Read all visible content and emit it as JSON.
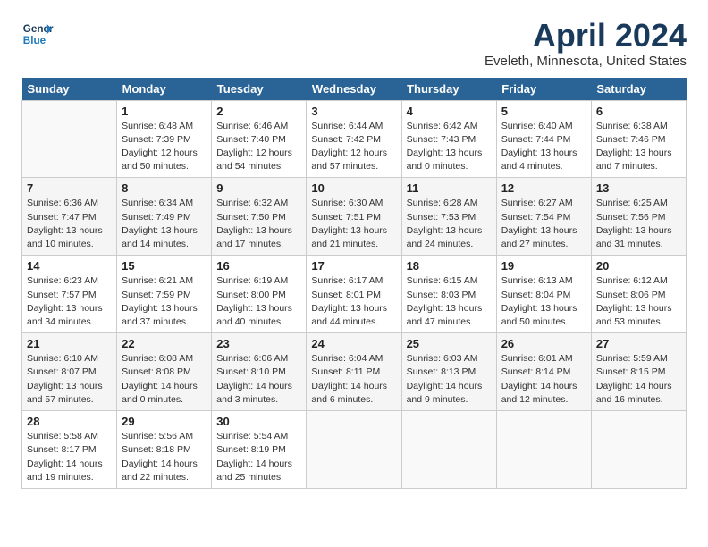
{
  "app": {
    "logo_line1": "General",
    "logo_line2": "Blue"
  },
  "title": {
    "month": "April 2024",
    "location": "Eveleth, Minnesota, United States"
  },
  "days_of_week": [
    "Sunday",
    "Monday",
    "Tuesday",
    "Wednesday",
    "Thursday",
    "Friday",
    "Saturday"
  ],
  "weeks": [
    [
      {
        "day": "",
        "sunrise": "",
        "sunset": "",
        "daylight": ""
      },
      {
        "day": "1",
        "sunrise": "Sunrise: 6:48 AM",
        "sunset": "Sunset: 7:39 PM",
        "daylight": "Daylight: 12 hours and 50 minutes."
      },
      {
        "day": "2",
        "sunrise": "Sunrise: 6:46 AM",
        "sunset": "Sunset: 7:40 PM",
        "daylight": "Daylight: 12 hours and 54 minutes."
      },
      {
        "day": "3",
        "sunrise": "Sunrise: 6:44 AM",
        "sunset": "Sunset: 7:42 PM",
        "daylight": "Daylight: 12 hours and 57 minutes."
      },
      {
        "day": "4",
        "sunrise": "Sunrise: 6:42 AM",
        "sunset": "Sunset: 7:43 PM",
        "daylight": "Daylight: 13 hours and 0 minutes."
      },
      {
        "day": "5",
        "sunrise": "Sunrise: 6:40 AM",
        "sunset": "Sunset: 7:44 PM",
        "daylight": "Daylight: 13 hours and 4 minutes."
      },
      {
        "day": "6",
        "sunrise": "Sunrise: 6:38 AM",
        "sunset": "Sunset: 7:46 PM",
        "daylight": "Daylight: 13 hours and 7 minutes."
      }
    ],
    [
      {
        "day": "7",
        "sunrise": "Sunrise: 6:36 AM",
        "sunset": "Sunset: 7:47 PM",
        "daylight": "Daylight: 13 hours and 10 minutes."
      },
      {
        "day": "8",
        "sunrise": "Sunrise: 6:34 AM",
        "sunset": "Sunset: 7:49 PM",
        "daylight": "Daylight: 13 hours and 14 minutes."
      },
      {
        "day": "9",
        "sunrise": "Sunrise: 6:32 AM",
        "sunset": "Sunset: 7:50 PM",
        "daylight": "Daylight: 13 hours and 17 minutes."
      },
      {
        "day": "10",
        "sunrise": "Sunrise: 6:30 AM",
        "sunset": "Sunset: 7:51 PM",
        "daylight": "Daylight: 13 hours and 21 minutes."
      },
      {
        "day": "11",
        "sunrise": "Sunrise: 6:28 AM",
        "sunset": "Sunset: 7:53 PM",
        "daylight": "Daylight: 13 hours and 24 minutes."
      },
      {
        "day": "12",
        "sunrise": "Sunrise: 6:27 AM",
        "sunset": "Sunset: 7:54 PM",
        "daylight": "Daylight: 13 hours and 27 minutes."
      },
      {
        "day": "13",
        "sunrise": "Sunrise: 6:25 AM",
        "sunset": "Sunset: 7:56 PM",
        "daylight": "Daylight: 13 hours and 31 minutes."
      }
    ],
    [
      {
        "day": "14",
        "sunrise": "Sunrise: 6:23 AM",
        "sunset": "Sunset: 7:57 PM",
        "daylight": "Daylight: 13 hours and 34 minutes."
      },
      {
        "day": "15",
        "sunrise": "Sunrise: 6:21 AM",
        "sunset": "Sunset: 7:59 PM",
        "daylight": "Daylight: 13 hours and 37 minutes."
      },
      {
        "day": "16",
        "sunrise": "Sunrise: 6:19 AM",
        "sunset": "Sunset: 8:00 PM",
        "daylight": "Daylight: 13 hours and 40 minutes."
      },
      {
        "day": "17",
        "sunrise": "Sunrise: 6:17 AM",
        "sunset": "Sunset: 8:01 PM",
        "daylight": "Daylight: 13 hours and 44 minutes."
      },
      {
        "day": "18",
        "sunrise": "Sunrise: 6:15 AM",
        "sunset": "Sunset: 8:03 PM",
        "daylight": "Daylight: 13 hours and 47 minutes."
      },
      {
        "day": "19",
        "sunrise": "Sunrise: 6:13 AM",
        "sunset": "Sunset: 8:04 PM",
        "daylight": "Daylight: 13 hours and 50 minutes."
      },
      {
        "day": "20",
        "sunrise": "Sunrise: 6:12 AM",
        "sunset": "Sunset: 8:06 PM",
        "daylight": "Daylight: 13 hours and 53 minutes."
      }
    ],
    [
      {
        "day": "21",
        "sunrise": "Sunrise: 6:10 AM",
        "sunset": "Sunset: 8:07 PM",
        "daylight": "Daylight: 13 hours and 57 minutes."
      },
      {
        "day": "22",
        "sunrise": "Sunrise: 6:08 AM",
        "sunset": "Sunset: 8:08 PM",
        "daylight": "Daylight: 14 hours and 0 minutes."
      },
      {
        "day": "23",
        "sunrise": "Sunrise: 6:06 AM",
        "sunset": "Sunset: 8:10 PM",
        "daylight": "Daylight: 14 hours and 3 minutes."
      },
      {
        "day": "24",
        "sunrise": "Sunrise: 6:04 AM",
        "sunset": "Sunset: 8:11 PM",
        "daylight": "Daylight: 14 hours and 6 minutes."
      },
      {
        "day": "25",
        "sunrise": "Sunrise: 6:03 AM",
        "sunset": "Sunset: 8:13 PM",
        "daylight": "Daylight: 14 hours and 9 minutes."
      },
      {
        "day": "26",
        "sunrise": "Sunrise: 6:01 AM",
        "sunset": "Sunset: 8:14 PM",
        "daylight": "Daylight: 14 hours and 12 minutes."
      },
      {
        "day": "27",
        "sunrise": "Sunrise: 5:59 AM",
        "sunset": "Sunset: 8:15 PM",
        "daylight": "Daylight: 14 hours and 16 minutes."
      }
    ],
    [
      {
        "day": "28",
        "sunrise": "Sunrise: 5:58 AM",
        "sunset": "Sunset: 8:17 PM",
        "daylight": "Daylight: 14 hours and 19 minutes."
      },
      {
        "day": "29",
        "sunrise": "Sunrise: 5:56 AM",
        "sunset": "Sunset: 8:18 PM",
        "daylight": "Daylight: 14 hours and 22 minutes."
      },
      {
        "day": "30",
        "sunrise": "Sunrise: 5:54 AM",
        "sunset": "Sunset: 8:19 PM",
        "daylight": "Daylight: 14 hours and 25 minutes."
      },
      {
        "day": "",
        "sunrise": "",
        "sunset": "",
        "daylight": ""
      },
      {
        "day": "",
        "sunrise": "",
        "sunset": "",
        "daylight": ""
      },
      {
        "day": "",
        "sunrise": "",
        "sunset": "",
        "daylight": ""
      },
      {
        "day": "",
        "sunrise": "",
        "sunset": "",
        "daylight": ""
      }
    ]
  ]
}
